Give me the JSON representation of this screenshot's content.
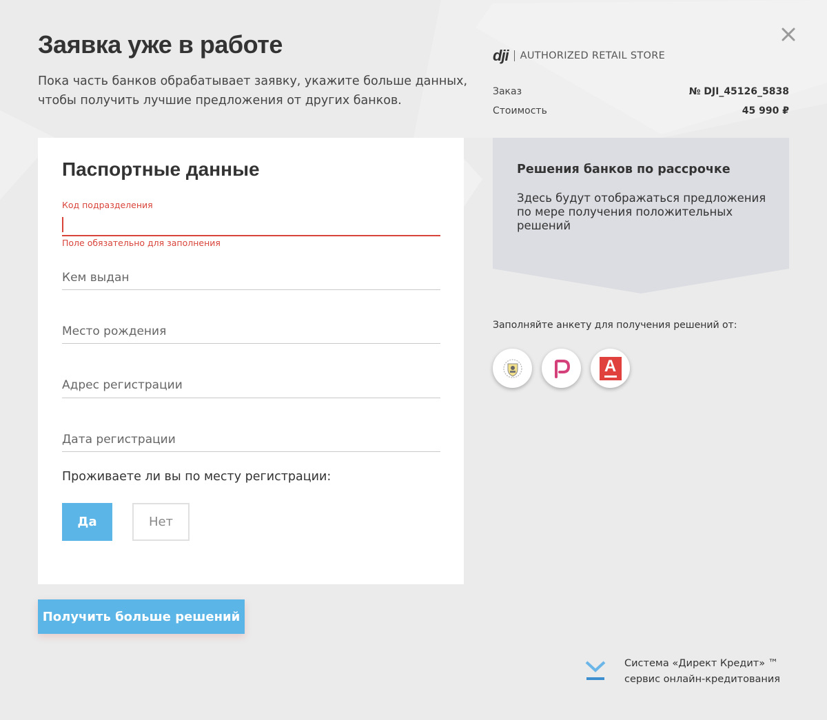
{
  "header": {
    "title": "Заявка уже в работе",
    "subtitle": "Пока часть банков обрабатывает заявку, укажите больше данных, чтобы получить лучшие предложения от других банков."
  },
  "form": {
    "title": "Паспортные данные",
    "fields": [
      {
        "label": "Код подразделения",
        "value": "",
        "error": "Поле обязательно для заполнения"
      },
      {
        "placeholder": "Кем выдан",
        "value": ""
      },
      {
        "placeholder": "Место рождения",
        "value": ""
      },
      {
        "placeholder": "Адрес регистрации",
        "value": ""
      },
      {
        "placeholder": "Дата регистрации",
        "value": ""
      }
    ],
    "question": "Проживаете ли вы по месту регистрации:",
    "options": {
      "yes": "Да",
      "no": "Нет",
      "selected": "yes"
    },
    "submit_label": "Получить больше решений"
  },
  "store": {
    "brand": "dji",
    "label": "AUTHORIZED RETAIL STORE"
  },
  "order": {
    "order_label": "Заказ",
    "order_value": "№ DJI_45126_5838",
    "price_label": "Стоимость",
    "price_value": "45 990 ₽"
  },
  "decisions": {
    "title": "Решения банков по рассрочке",
    "text": "Здесь будут отображаться предложения по мере получения положительных решений"
  },
  "banks": {
    "note": "Заполняйте анкету для получения решений от:",
    "items": [
      {
        "icon": "tinkoff-bank-icon"
      },
      {
        "icon": "renaissance-bank-icon"
      },
      {
        "icon": "alfa-bank-icon",
        "letter": "А"
      }
    ]
  },
  "footer": {
    "line1": "Система «Директ Кредит» ™",
    "line2": "сервис онлайн-кредитования"
  },
  "colors": {
    "accent": "#5bb5e6",
    "error": "#d9443a",
    "background": "#ebebeb",
    "decisions_box": "#dcdde2",
    "alfa_red": "#e0413d",
    "renaissance_pink": "#d4407a",
    "footer_blue": "#3e8fcf"
  }
}
